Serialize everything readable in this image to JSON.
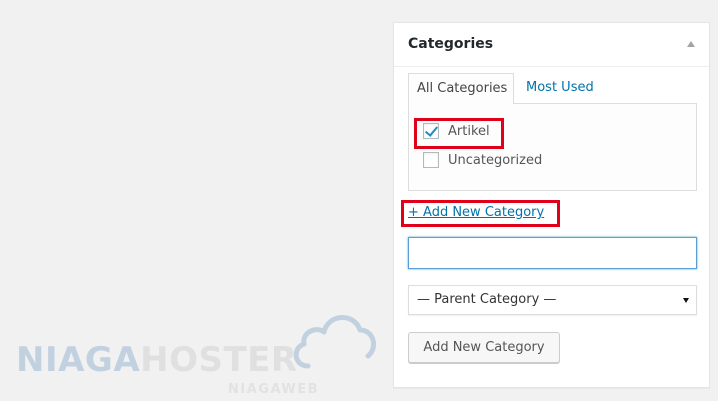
{
  "categories_box": {
    "title": "Categories",
    "tabs": [
      {
        "label": "All Categories",
        "active": true
      },
      {
        "label": "Most Used",
        "active": false
      }
    ],
    "items": [
      {
        "label": "Artikel",
        "checked": true
      },
      {
        "label": "Uncategorized",
        "checked": false
      }
    ],
    "add_new_link": "+ Add New Category",
    "new_category_input": {
      "value": "",
      "placeholder": ""
    },
    "parent_select": {
      "selected": "— Parent Category —"
    },
    "add_button": "Add New Category"
  },
  "watermark": {
    "brand_part1": "NIAGA",
    "brand_part2": "HOSTER",
    "sub": "NIAGAWEB"
  },
  "colors": {
    "link": "#0073aa",
    "highlight": "#e1001a",
    "checkmark": "#1e8cbe",
    "focus": "#5b9dd9"
  }
}
